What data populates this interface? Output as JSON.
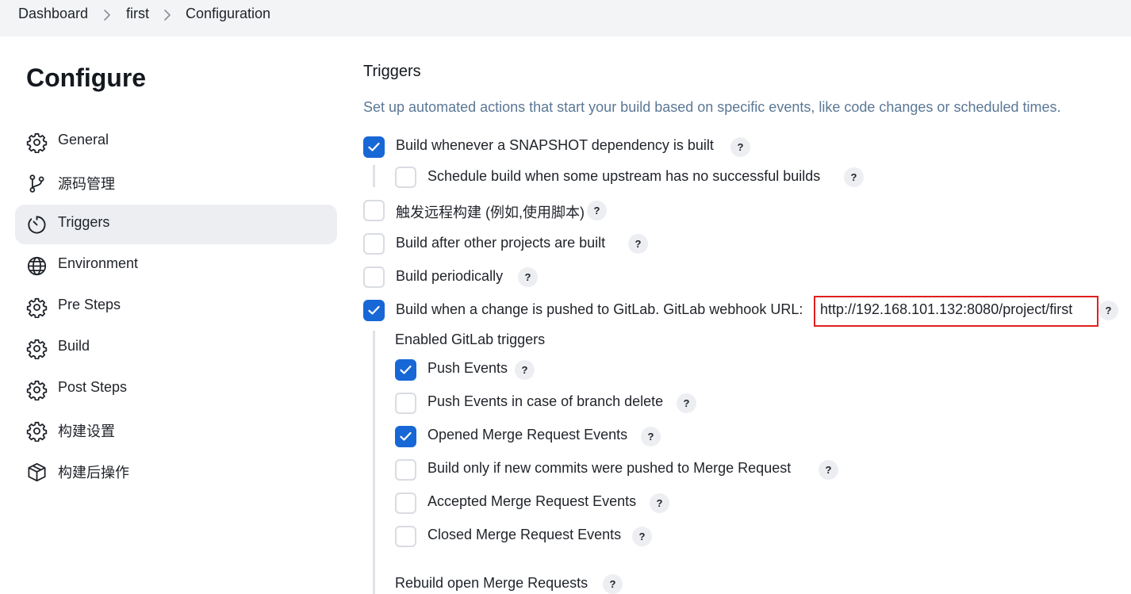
{
  "breadcrumb": {
    "items": [
      "Dashboard",
      "first",
      "Configuration"
    ]
  },
  "sidebar": {
    "title": "Configure",
    "items": [
      {
        "label": "General",
        "icon": "gear-icon"
      },
      {
        "label": "源码管理",
        "icon": "branch-icon"
      },
      {
        "label": "Triggers",
        "icon": "timer-icon",
        "active": true
      },
      {
        "label": "Environment",
        "icon": "globe-icon"
      },
      {
        "label": "Pre Steps",
        "icon": "gear-icon"
      },
      {
        "label": "Build",
        "icon": "gear-icon"
      },
      {
        "label": "Post Steps",
        "icon": "gear-icon"
      },
      {
        "label": "构建设置",
        "icon": "gear-icon"
      },
      {
        "label": "构建后操作",
        "icon": "package-icon"
      }
    ]
  },
  "main": {
    "section_title": "Triggers",
    "section_description": "Set up automated actions that start your build based on specific events, like code changes or scheduled times.",
    "help_label": "?",
    "triggers": [
      {
        "label": "Build whenever a SNAPSHOT dependency is built",
        "checked": true
      },
      {
        "label": "Schedule build when some upstream has no successful builds",
        "checked": false
      },
      {
        "label": "触发远程构建 (例如,使用脚本)",
        "checked": false
      },
      {
        "label": "Build after other projects are built",
        "checked": false
      },
      {
        "label": "Build periodically",
        "checked": false
      },
      {
        "label": "Build when a change is pushed to GitLab. GitLab webhook URL:",
        "checked": true
      }
    ],
    "webhook_url": "http://192.168.101.132:8080/project/first",
    "gitlab_triggers_heading": "Enabled GitLab triggers",
    "gitlab_triggers": [
      {
        "label": "Push Events",
        "checked": true
      },
      {
        "label": "Push Events in case of branch delete",
        "checked": false
      },
      {
        "label": "Opened Merge Request Events",
        "checked": true
      },
      {
        "label": "Build only if new commits were pushed to Merge Request",
        "checked": false
      },
      {
        "label": "Accepted Merge Request Events",
        "checked": false
      },
      {
        "label": "Closed Merge Request Events",
        "checked": false
      }
    ],
    "rebuild_label": "Rebuild open Merge Requests"
  },
  "colors": {
    "accent": "#1867d6",
    "highlight_border": "#e02020",
    "description_text": "#5b7896",
    "active_nav_bg": "#eceef2"
  }
}
